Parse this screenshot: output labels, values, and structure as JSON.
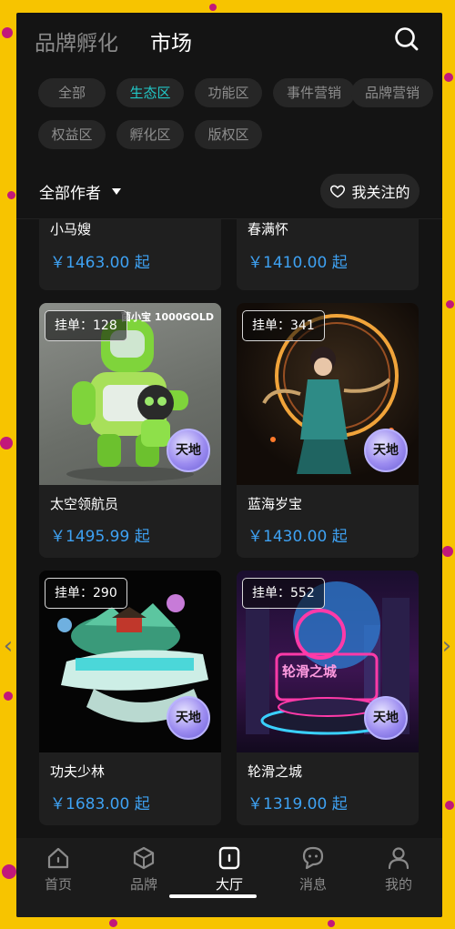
{
  "header": {
    "tabs": [
      {
        "label": "品牌孵化",
        "active": false
      },
      {
        "label": "市场",
        "active": true
      }
    ]
  },
  "categories": [
    {
      "label": "全部",
      "active": false
    },
    {
      "label": "生态区",
      "active": true
    },
    {
      "label": "功能区",
      "active": false
    },
    {
      "label": "事件营销",
      "active": false
    },
    {
      "label": "品牌营销",
      "active": false
    },
    {
      "label": "权益区",
      "active": false
    },
    {
      "label": "孵化区",
      "active": false
    },
    {
      "label": "版权区",
      "active": false
    }
  ],
  "filters": {
    "author_label": "全部作者",
    "follow_label": "我关注的"
  },
  "products": [
    {
      "name": "小马嫂",
      "price": "￥1463.00 起",
      "listing": ""
    },
    {
      "name": "春满怀",
      "price": "￥1410.00 起",
      "listing": ""
    },
    {
      "name": "太空领航员",
      "price": "￥1495.99 起",
      "listing": "挂单：128",
      "brand_mark": "天地",
      "art_text": "菌小宝 1000GOLD"
    },
    {
      "name": "蓝海岁宝",
      "price": "￥1430.00 起",
      "listing": "挂单：341",
      "brand_mark": "天地"
    },
    {
      "name": "功夫少林",
      "price": "￥1683.00 起",
      "listing": "挂单：290",
      "brand_mark": "天地"
    },
    {
      "name": "轮滑之城",
      "price": "￥1319.00 起",
      "listing": "挂单：552",
      "brand_mark": "天地",
      "art_text": "轮滑之城"
    }
  ],
  "tabbar": [
    {
      "label": "首页",
      "icon": "home-icon",
      "active": false
    },
    {
      "label": "品牌",
      "icon": "cube-icon",
      "active": false
    },
    {
      "label": "大厅",
      "icon": "hall-icon",
      "active": true
    },
    {
      "label": "消息",
      "icon": "message-icon",
      "active": false
    },
    {
      "label": "我的",
      "icon": "person-icon",
      "active": false
    }
  ],
  "colors": {
    "accent_teal": "#21c7c6",
    "price_blue": "#3ea1f2",
    "backdrop_yellow": "#f7c400",
    "backdrop_magenta": "#c2187a"
  }
}
